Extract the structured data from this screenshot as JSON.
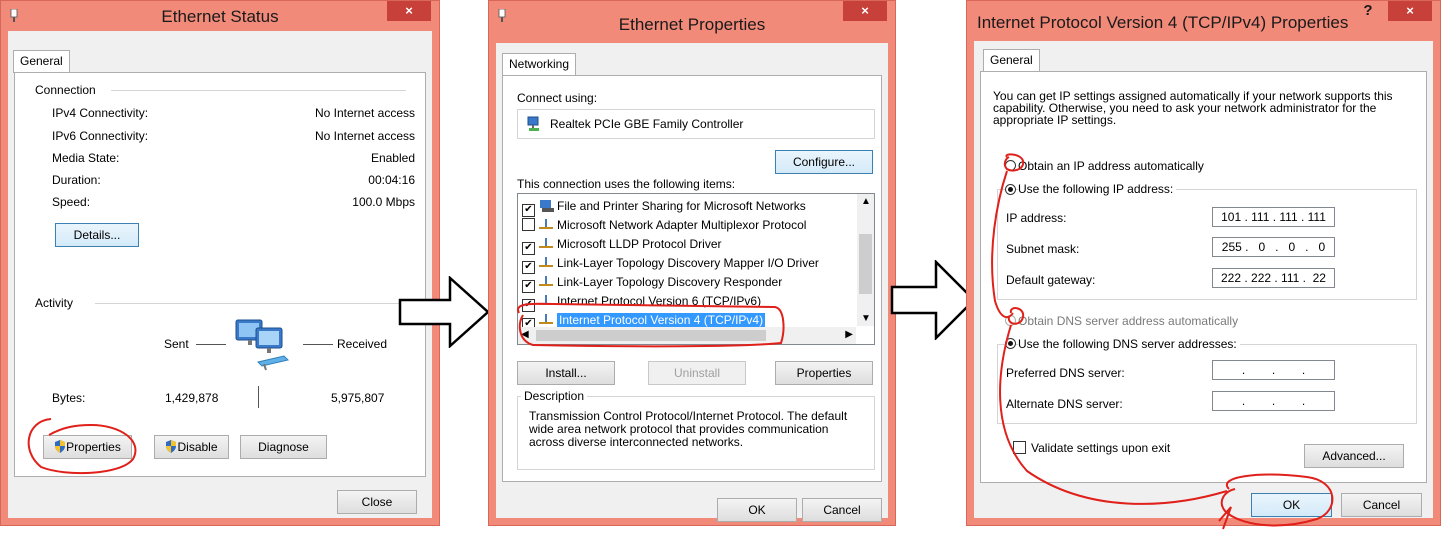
{
  "ethernet_status": {
    "title": "Ethernet Status",
    "close_glyph": "×",
    "tab": "General",
    "connection_label": "Connection",
    "rows": [
      {
        "label": "IPv4 Connectivity:",
        "value": "No Internet access"
      },
      {
        "label": "IPv6 Connectivity:",
        "value": "No Internet access"
      },
      {
        "label": "Media State:",
        "value": "Enabled"
      },
      {
        "label": "Duration:",
        "value": "00:04:16"
      },
      {
        "label": "Speed:",
        "value": "100.0 Mbps"
      }
    ],
    "details_button": "Details...",
    "activity_label": "Activity",
    "sent_label": "Sent",
    "received_label": "Received",
    "bytes_label": "Bytes:",
    "bytes_sent": "1,429,878",
    "bytes_received": "5,975,807",
    "properties_button": "Properties",
    "disable_button": "Disable",
    "diagnose_button": "Diagnose",
    "close_button": "Close"
  },
  "ethernet_properties": {
    "title": "Ethernet Properties",
    "close_glyph": "×",
    "tab": "Networking",
    "connect_using_label": "Connect using:",
    "adapter_name": "Realtek PCIe GBE Family Controller",
    "configure_button": "Configure...",
    "items_label": "This connection uses the following items:",
    "items": [
      {
        "label": "File and Printer Sharing for Microsoft Networks",
        "checked": true
      },
      {
        "label": "Microsoft Network Adapter Multiplexor Protocol",
        "checked": false
      },
      {
        "label": "Microsoft LLDP Protocol Driver",
        "checked": true
      },
      {
        "label": "Link-Layer Topology Discovery Mapper I/O Driver",
        "checked": true
      },
      {
        "label": "Link-Layer Topology Discovery Responder",
        "checked": true
      },
      {
        "label": "Internet Protocol Version 6 (TCP/IPv6)",
        "checked": true
      },
      {
        "label": "Internet Protocol Version 4 (TCP/IPv4)",
        "checked": true,
        "selected": true
      }
    ],
    "install_button": "Install...",
    "uninstall_button": "Uninstall",
    "properties_button": "Properties",
    "description_label": "Description",
    "description_text": "Transmission Control Protocol/Internet Protocol. The default wide area network protocol that provides communication across diverse interconnected networks.",
    "ok_button": "OK",
    "cancel_button": "Cancel"
  },
  "ipv4_properties": {
    "title": "Internet Protocol Version 4 (TCP/IPv4) Properties",
    "help_glyph": "?",
    "close_glyph": "×",
    "tab": "General",
    "intro_text": "You can get IP settings assigned automatically if your network supports this capability. Otherwise, you need to ask your network administrator for the appropriate IP settings.",
    "obtain_ip_auto": "Obtain an IP address automatically",
    "use_following_ip": "Use the following IP address:",
    "ip_address_label": "IP address:",
    "ip_address_value": "101 . 111 . 111 . 111",
    "subnet_mask_label": "Subnet mask:",
    "subnet_mask_value": "255 .   0   .   0   .   0",
    "default_gateway_label": "Default gateway:",
    "default_gateway_value": "222 . 222 . 111 .  22",
    "obtain_dns_auto": "Obtain DNS server address automatically",
    "use_following_dns": "Use the following DNS server addresses:",
    "preferred_dns_label": "Preferred DNS server:",
    "preferred_dns_value": ".        .        .",
    "alternate_dns_label": "Alternate DNS server:",
    "alternate_dns_value": ".        .        .",
    "validate_label": "Validate settings upon exit",
    "advanced_button": "Advanced...",
    "ok_button": "OK",
    "cancel_button": "Cancel"
  },
  "colors": {
    "window_frame": "#f28a7a",
    "close_button": "#c7403a",
    "annotation_red": "#e0201a",
    "selection_blue": "#3399ff"
  }
}
